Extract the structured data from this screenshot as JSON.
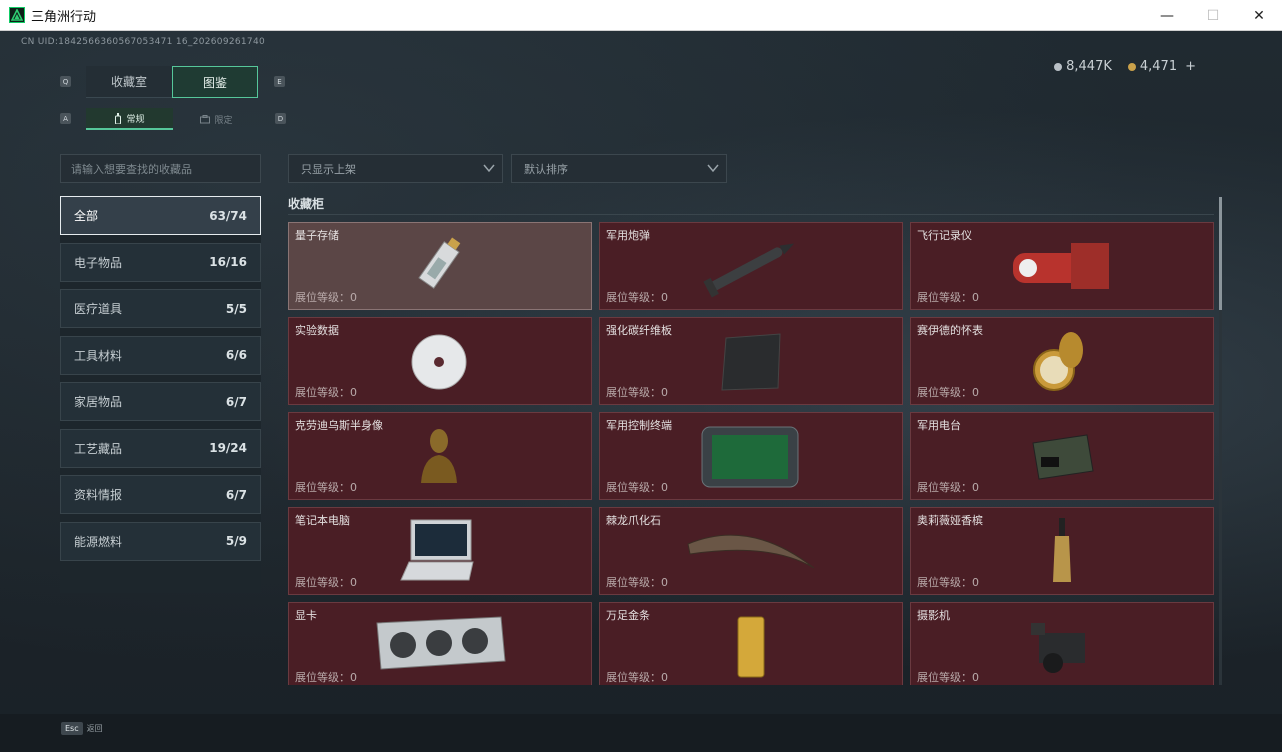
{
  "window": {
    "title": "三角洲行动",
    "minimize": "—",
    "maximize": "☐",
    "close": "✕"
  },
  "uid": "CN UID:1842566360567053471 16_202609261740",
  "currency": {
    "silver": "8,447K",
    "gold": "4,471",
    "add": "+"
  },
  "keys": {
    "q": "Q",
    "e": "E",
    "a": "A",
    "d": "D"
  },
  "main_tabs": [
    {
      "label": "收藏室",
      "active": false
    },
    {
      "label": "图鉴",
      "active": true
    }
  ],
  "sub_tabs": [
    {
      "label": "常规",
      "icon": "bottle-icon",
      "active": true
    },
    {
      "label": "限定",
      "icon": "limited-icon",
      "active": false
    }
  ],
  "search": {
    "placeholder": "请输入想要查找的收藏品"
  },
  "filter": {
    "label": "只显示上架"
  },
  "sort": {
    "label": "默认排序"
  },
  "categories": [
    {
      "label": "全部",
      "count": "63/74"
    },
    {
      "label": "电子物品",
      "count": "16/16"
    },
    {
      "label": "医疗道具",
      "count": "5/5"
    },
    {
      "label": "工具材料",
      "count": "6/6"
    },
    {
      "label": "家居物品",
      "count": "6/7"
    },
    {
      "label": "工艺藏品",
      "count": "19/24"
    },
    {
      "label": "资料情报",
      "count": "6/7"
    },
    {
      "label": "能源燃料",
      "count": "5/9"
    }
  ],
  "section_title": "收藏柜",
  "level_label": "展位等级：0",
  "items": [
    {
      "name": "量子存储",
      "icon": "usb-drive-icon"
    },
    {
      "name": "军用炮弹",
      "icon": "missile-icon"
    },
    {
      "name": "飞行记录仪",
      "icon": "flight-recorder-icon"
    },
    {
      "name": "实验数据",
      "icon": "disc-icon"
    },
    {
      "name": "强化碳纤维板",
      "icon": "carbon-plate-icon"
    },
    {
      "name": "赛伊德的怀表",
      "icon": "pocket-watch-icon"
    },
    {
      "name": "克劳迪乌斯半身像",
      "icon": "bust-icon"
    },
    {
      "name": "军用控制终端",
      "icon": "terminal-icon"
    },
    {
      "name": "军用电台",
      "icon": "radio-icon"
    },
    {
      "name": "笔记本电脑",
      "icon": "laptop-icon"
    },
    {
      "name": "棘龙爪化石",
      "icon": "claw-fossil-icon"
    },
    {
      "name": "奥莉薇娅香槟",
      "icon": "champagne-icon"
    },
    {
      "name": "显卡",
      "icon": "gpu-icon"
    },
    {
      "name": "万足金条",
      "icon": "gold-bar-icon"
    },
    {
      "name": "摄影机",
      "icon": "camera-icon"
    }
  ],
  "esc": {
    "key": "Esc",
    "label": "返回"
  }
}
